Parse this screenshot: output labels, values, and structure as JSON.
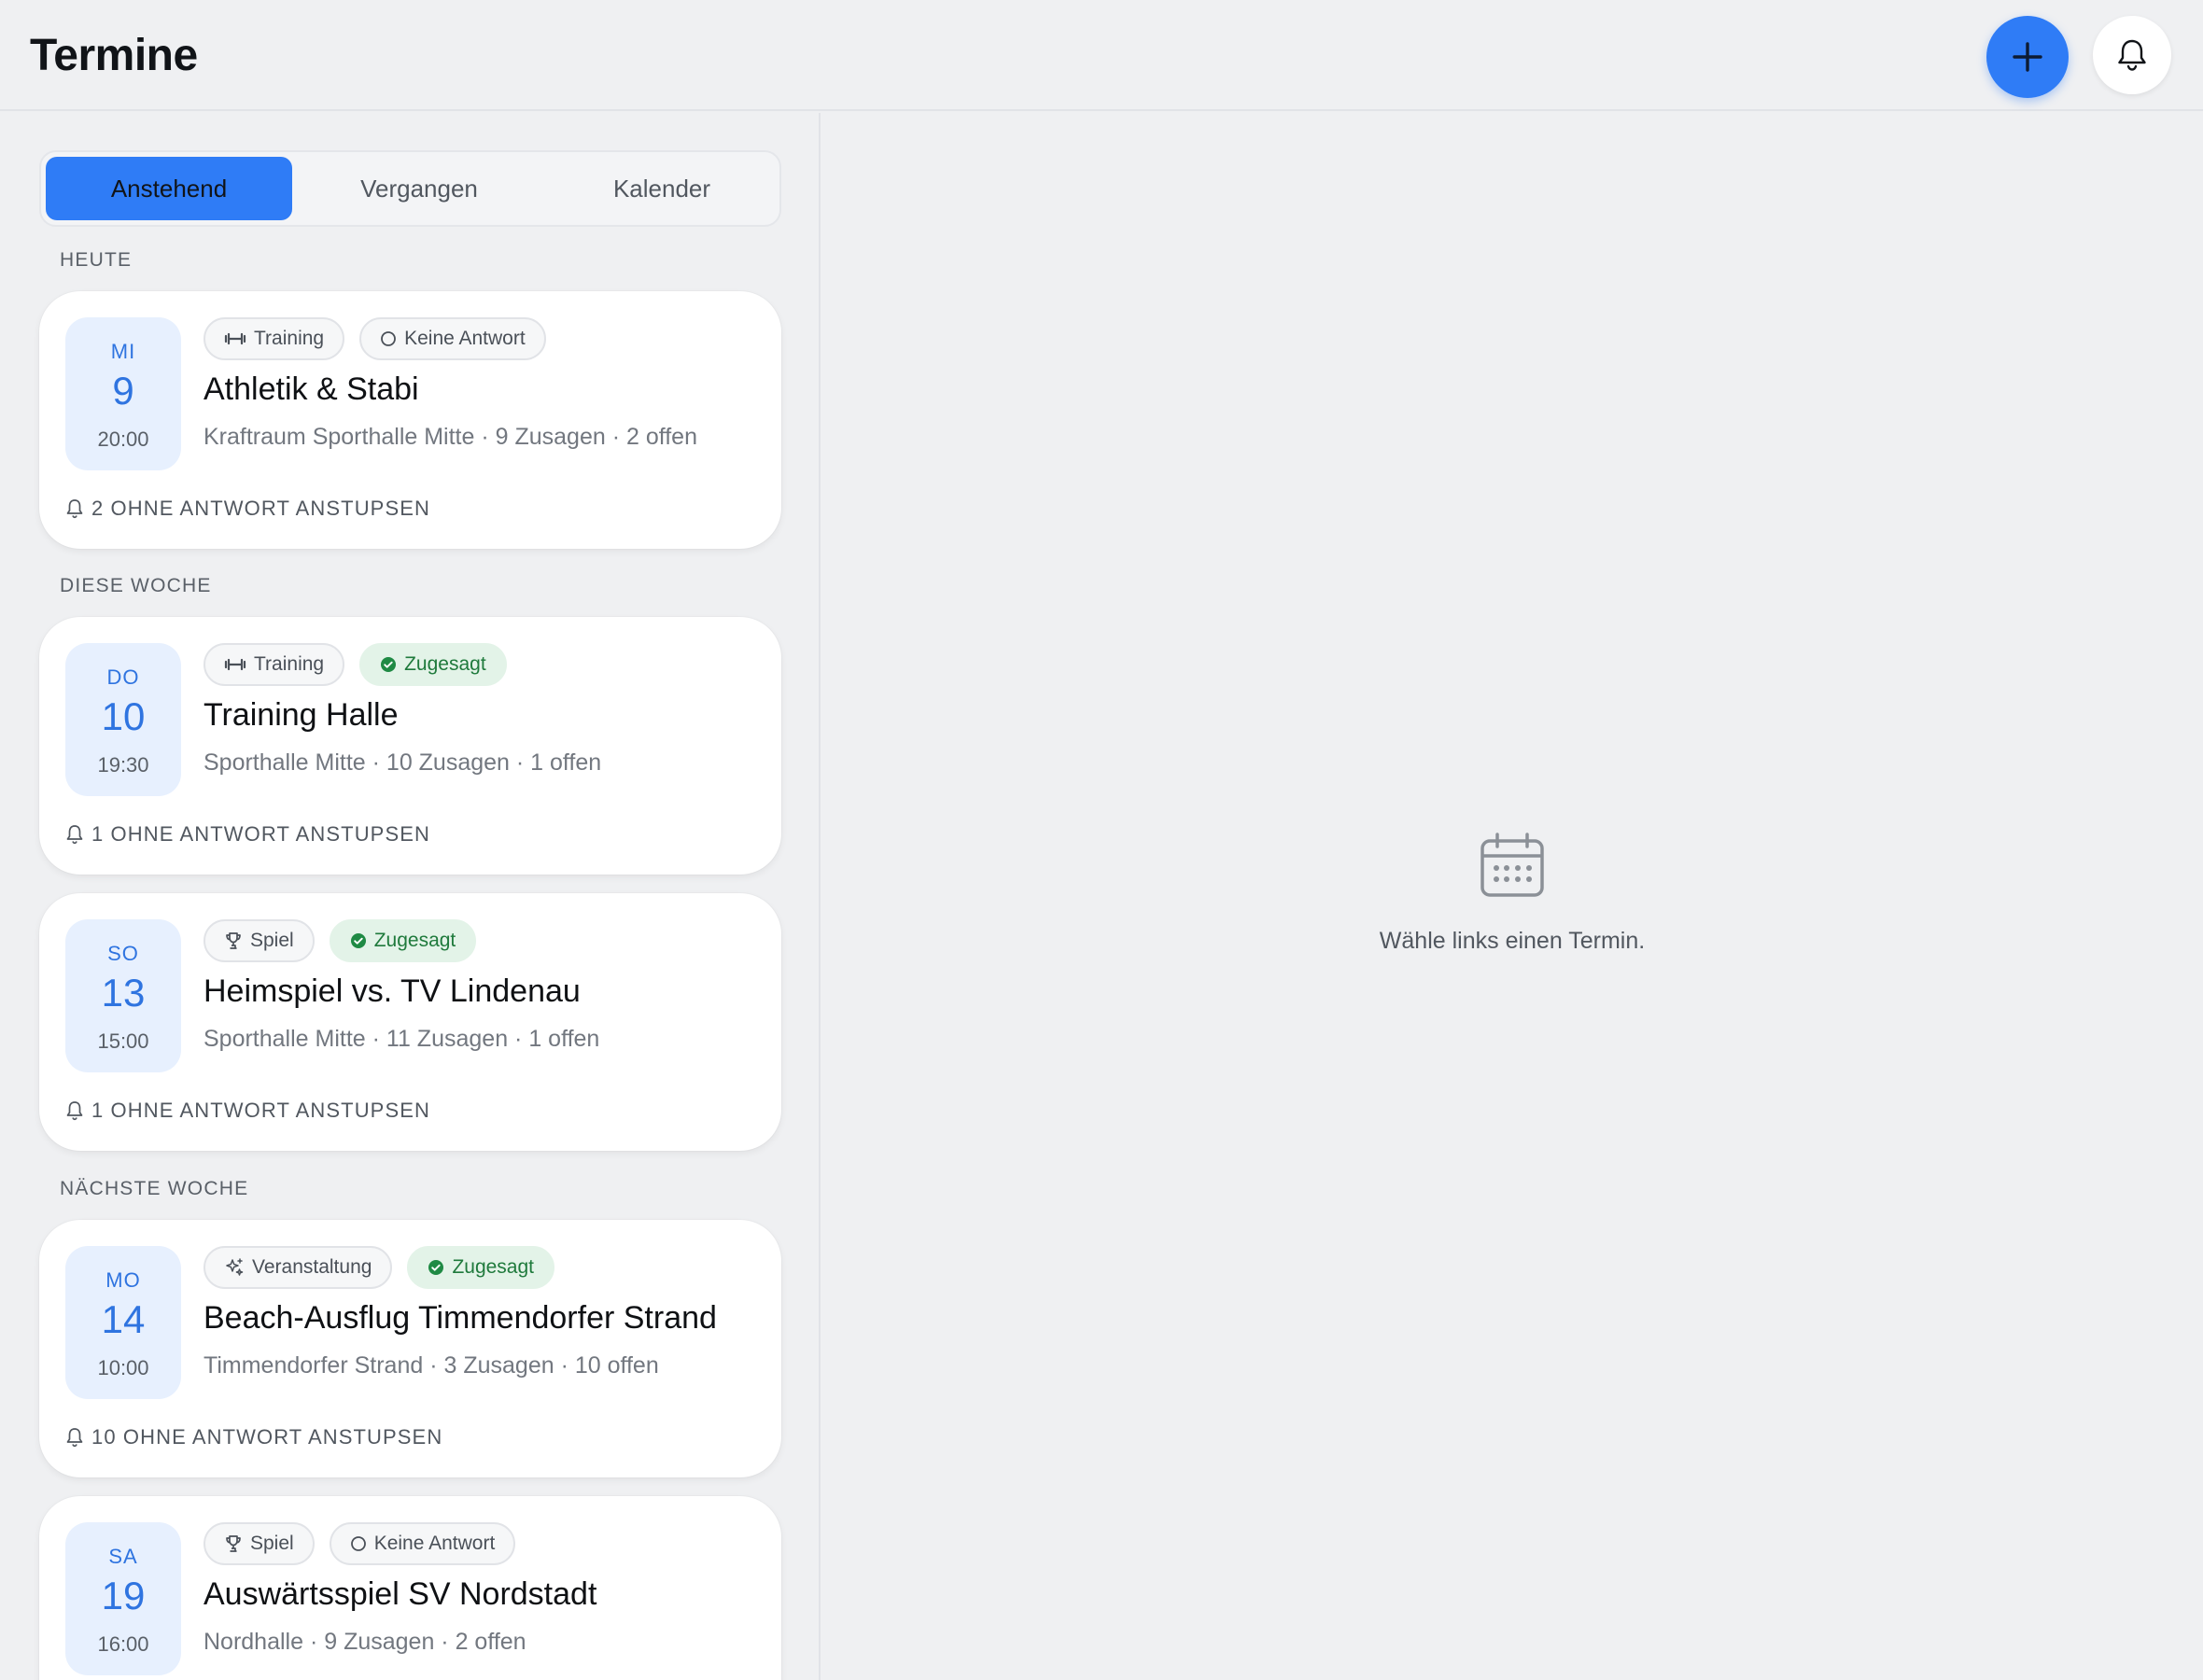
{
  "header": {
    "title": "Termine",
    "add_icon": "plus-icon",
    "bell_icon": "bell-icon"
  },
  "tabs": [
    {
      "label": "Anstehend",
      "active": true
    },
    {
      "label": "Vergangen",
      "active": false
    },
    {
      "label": "Kalender",
      "active": false
    }
  ],
  "sections": {
    "today": "HEUTE",
    "this_week": "DIESE WOCHE",
    "next_week": "NÄCHSTE WOCHE"
  },
  "events": [
    {
      "dow": "MI",
      "day": "9",
      "time": "20:00",
      "type": "Training",
      "type_icon": "dumbbell-icon",
      "status": "Keine Antwort",
      "status_icon": "circle-icon",
      "title": "Athletik & Stabi",
      "subtitle": "Kraftraum Sporthalle Mitte · 9 Zusagen · 2 offen",
      "nudge": "2 OHNE ANTWORT ANSTUPSEN"
    },
    {
      "dow": "DO",
      "day": "10",
      "time": "19:30",
      "type": "Training",
      "type_icon": "dumbbell-icon",
      "status": "Zugesagt",
      "status_icon": "check-circle-icon",
      "title": "Training Halle",
      "subtitle": "Sporthalle Mitte · 10 Zusagen · 1 offen",
      "nudge": "1 OHNE ANTWORT ANSTUPSEN"
    },
    {
      "dow": "SO",
      "day": "13",
      "time": "15:00",
      "type": "Spiel",
      "type_icon": "trophy-icon",
      "status": "Zugesagt",
      "status_icon": "check-circle-icon",
      "title": "Heimspiel vs. TV Lindenau",
      "subtitle": "Sporthalle Mitte · 11 Zusagen · 1 offen",
      "nudge": "1 OHNE ANTWORT ANSTUPSEN"
    },
    {
      "dow": "MO",
      "day": "14",
      "time": "10:00",
      "type": "Veranstaltung",
      "type_icon": "sparkles-icon",
      "status": "Zugesagt",
      "status_icon": "check-circle-icon",
      "title": "Beach-Ausflug Timmendorfer Strand",
      "subtitle": "Timmendorfer Strand · 3 Zusagen · 10 offen",
      "nudge": "10 OHNE ANTWORT ANSTUPSEN"
    },
    {
      "dow": "SA",
      "day": "19",
      "time": "16:00",
      "type": "Spiel",
      "type_icon": "trophy-icon",
      "status": "Keine Antwort",
      "status_icon": "circle-icon",
      "title": "Auswärtsspiel SV Nordstadt",
      "subtitle": "Nordhalle · 9 Zusagen · 2 offen",
      "nudge": ""
    }
  ],
  "empty_state": {
    "icon": "calendar-icon",
    "text": "Wähle links einen Termin."
  },
  "colors": {
    "accent": "#2f7cf6",
    "background": "#eff0f2",
    "confirmed_bg": "#e3f3e8",
    "confirmed_text": "#1f7a3c"
  }
}
